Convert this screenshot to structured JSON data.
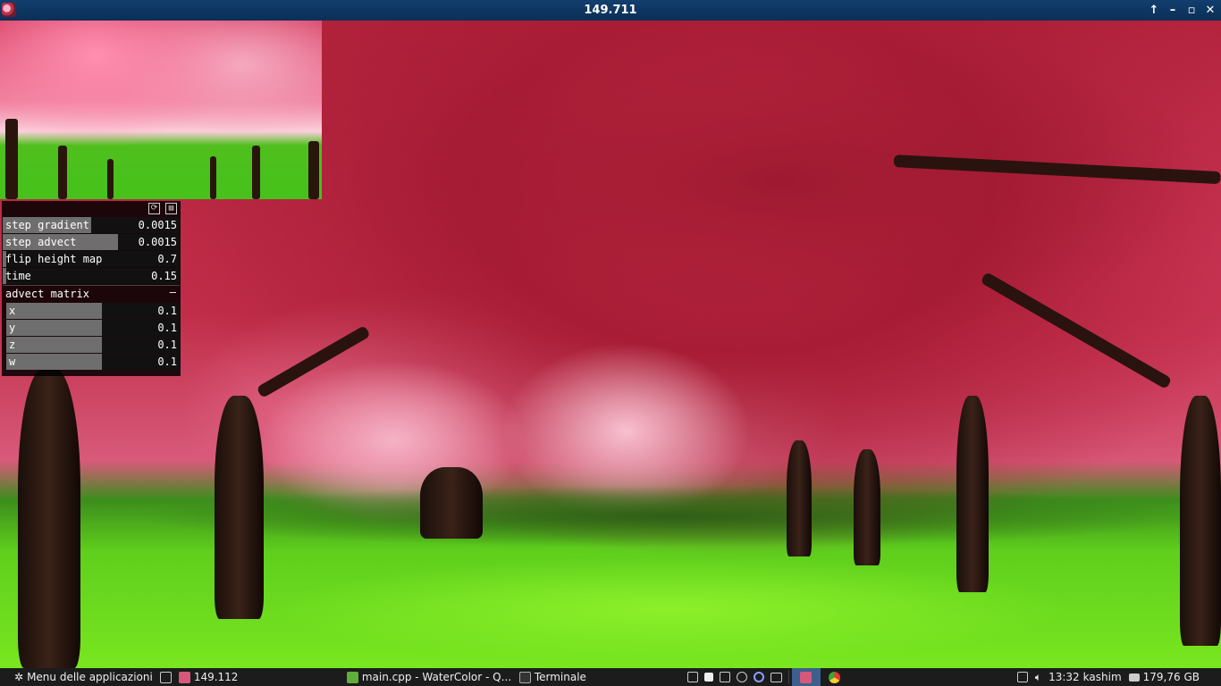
{
  "window": {
    "title": "149.711"
  },
  "title_controls": {
    "up": "↑",
    "minimize": "–",
    "maximize": "▫",
    "close": "✕"
  },
  "gui": {
    "sliders": [
      {
        "label": "step gradient",
        "value": "0.0015",
        "fill": 0.5
      },
      {
        "label": "step advect",
        "value": "0.0015",
        "fill": 0.65
      },
      {
        "label": "flip height map",
        "value": "0.7",
        "fill": 0.02
      },
      {
        "label": "time",
        "value": "0.15",
        "fill": 0.02
      }
    ],
    "group": {
      "label": "advect matrix",
      "collapse": "–"
    },
    "matrix": [
      {
        "label": "x",
        "value": "0.1",
        "fill": 0.55
      },
      {
        "label": "y",
        "value": "0.1",
        "fill": 0.55
      },
      {
        "label": "z",
        "value": "0.1",
        "fill": 0.55
      },
      {
        "label": "w",
        "value": "0.1",
        "fill": 0.55
      }
    ]
  },
  "taskbar": {
    "menu": "Menu delle applicazioni",
    "window1": "149.112",
    "window2": "main.cpp - WaterColor - Q...",
    "window3": "Terminale",
    "clock": "13:32",
    "user": "kashim",
    "disk": "179,76 GB"
  },
  "colors": {
    "titlebar": "#0b2f57",
    "taskbar": "#1c1c1c",
    "slider_fill": "#6e6e6e"
  }
}
